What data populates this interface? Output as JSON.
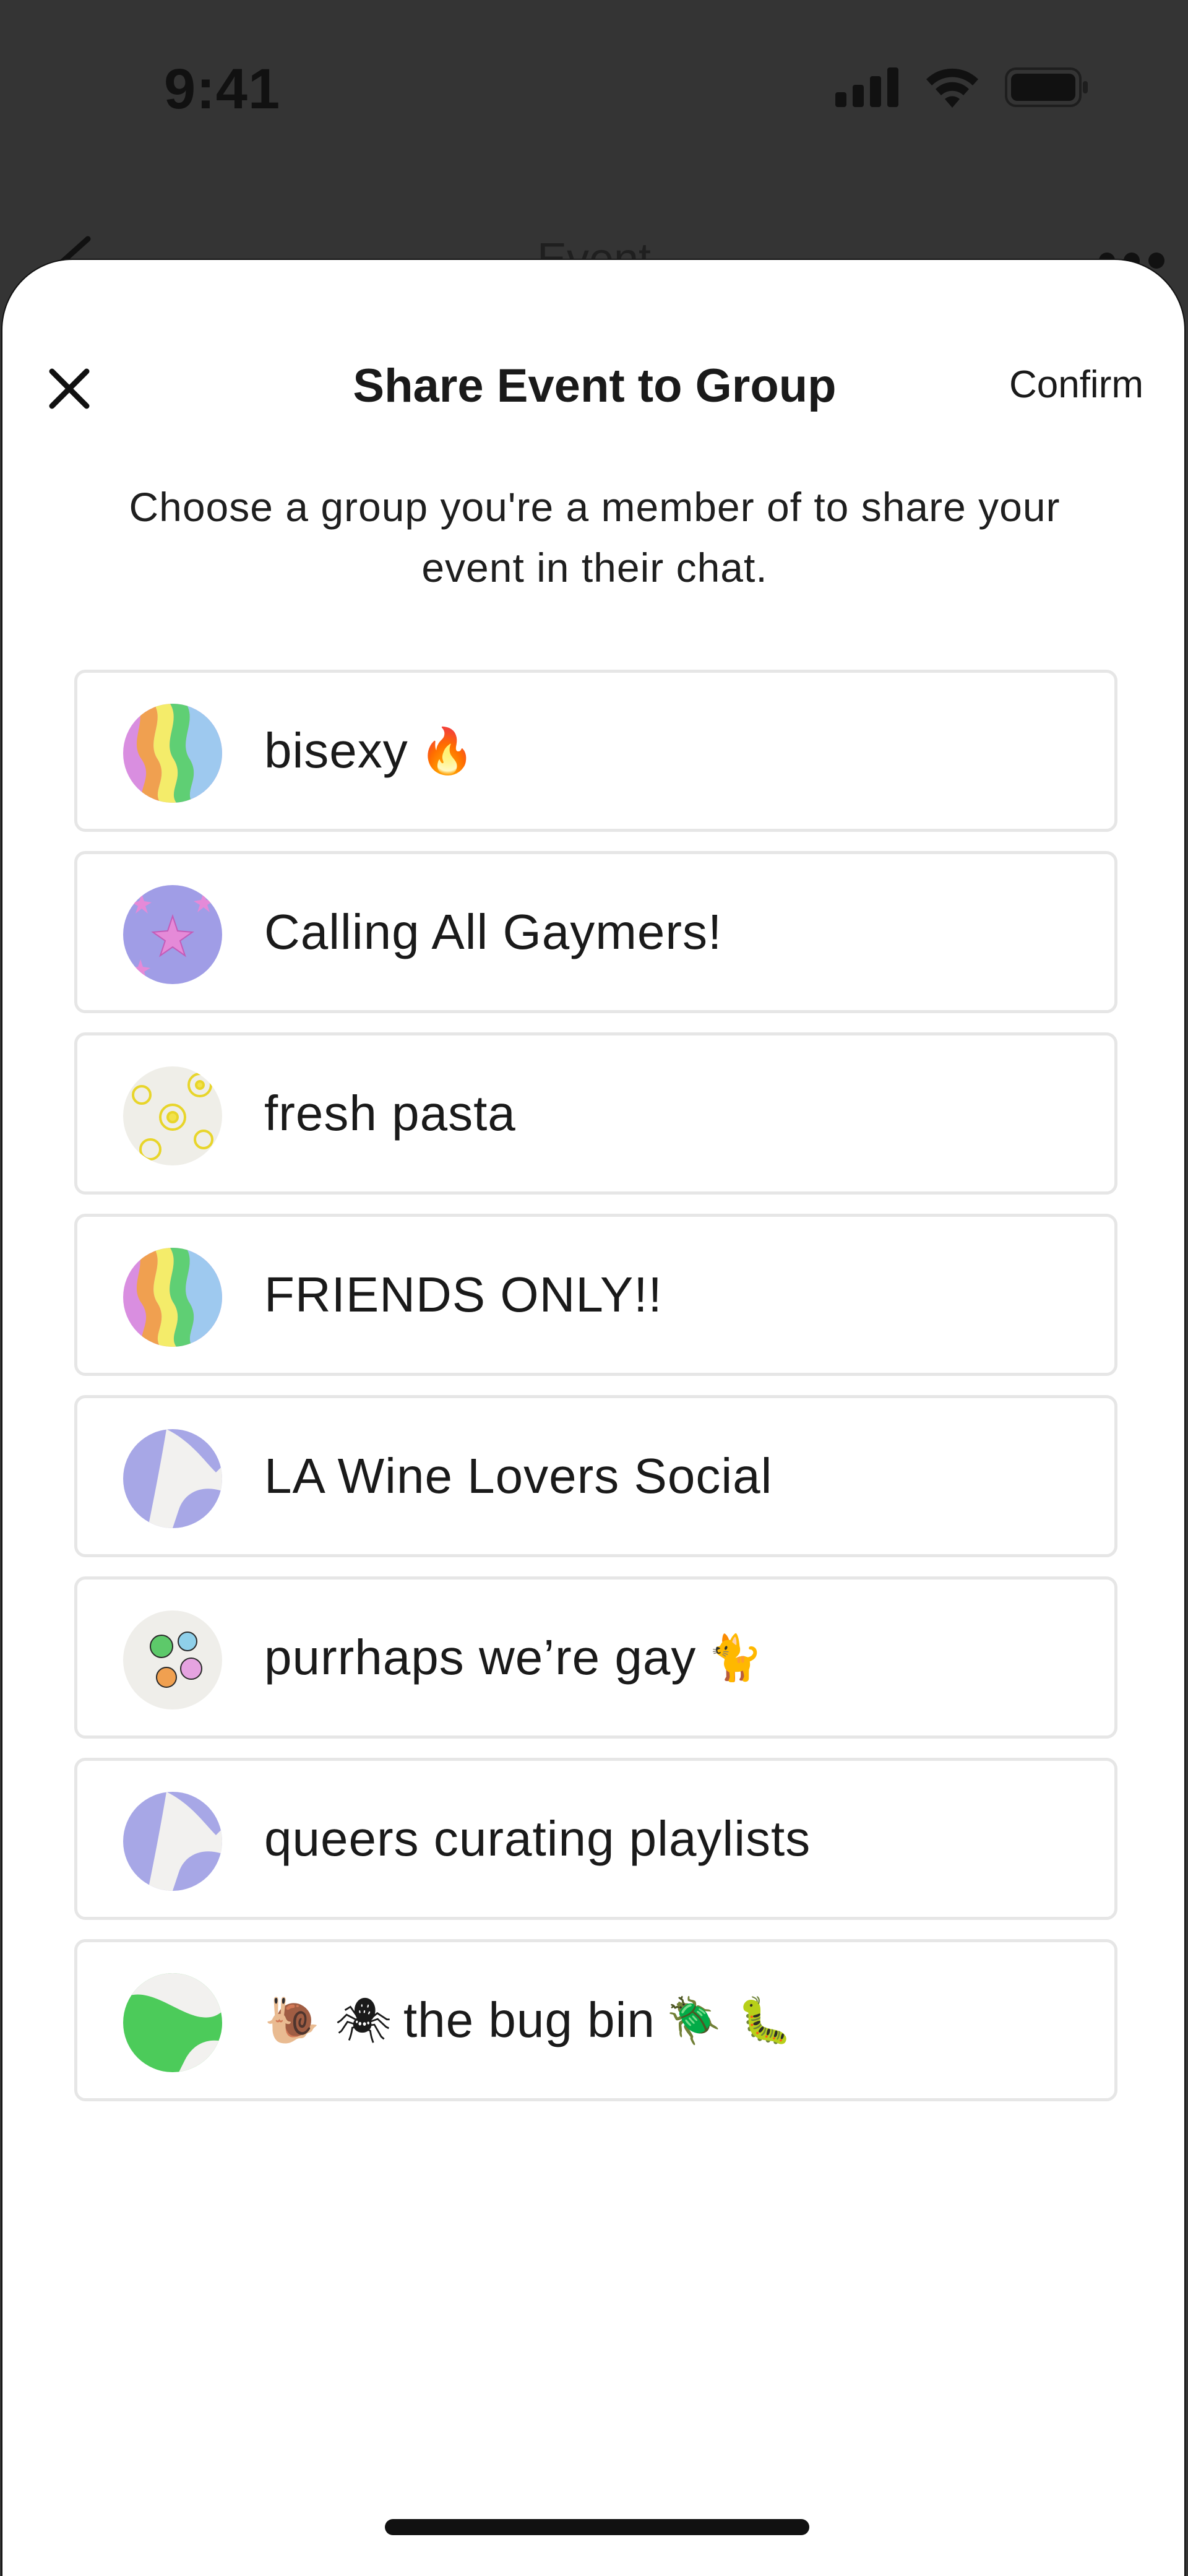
{
  "status_bar": {
    "time": "9:41",
    "icons": [
      "signal-icon",
      "wifi-icon",
      "battery-icon"
    ]
  },
  "background_nav": {
    "title": "Event",
    "icons": [
      "back-chevron-icon",
      "more-icon"
    ]
  },
  "sheet": {
    "title": "Share Event to Group",
    "confirm_label": "Confirm",
    "close_icon": "close-icon",
    "subtitle": "Choose a group you're a member of to share your event in their chat."
  },
  "groups": [
    {
      "name": "bisexy",
      "suffix_emoji": "🔥",
      "prefix_emoji": "",
      "avatar": "rainbow-waves"
    },
    {
      "name": "Calling All Gaymers!",
      "suffix_emoji": "",
      "prefix_emoji": "",
      "avatar": "purple-stars"
    },
    {
      "name": "fresh pasta",
      "suffix_emoji": "",
      "prefix_emoji": "",
      "avatar": "yellow-flowers"
    },
    {
      "name": "FRIENDS ONLY!!",
      "suffix_emoji": "",
      "prefix_emoji": "",
      "avatar": "rainbow-waves"
    },
    {
      "name": "LA Wine Lovers Social",
      "suffix_emoji": "",
      "prefix_emoji": "",
      "avatar": "lavender-swoosh"
    },
    {
      "name": "purrhaps we’re gay",
      "suffix_emoji": "🐈",
      "prefix_emoji": "",
      "avatar": "smiley-dots"
    },
    {
      "name": "queers curating playlists",
      "suffix_emoji": "",
      "prefix_emoji": "",
      "avatar": "lavender-swoosh"
    },
    {
      "name": "the bug bin",
      "suffix_emoji": "🪲 🐛",
      "prefix_emoji": "🐌 🕷",
      "avatar": "green-swoosh"
    }
  ],
  "colors": {
    "sheet_bg": "#ffffff",
    "backdrop": "#343434",
    "item_border": "#e6e6e6",
    "text": "#1a1a1a"
  }
}
